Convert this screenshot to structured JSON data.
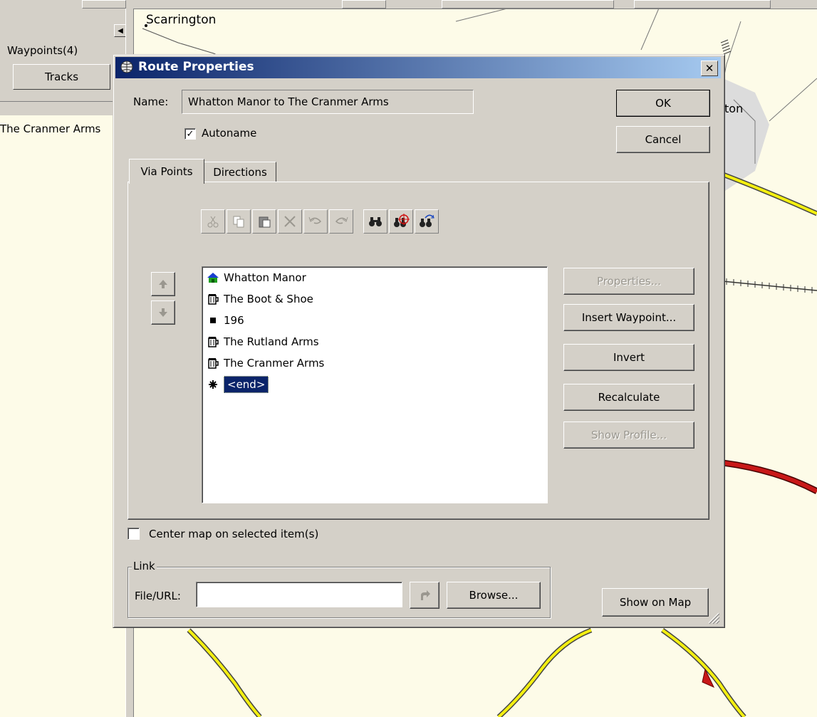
{
  "background": {
    "map_label": "Scarrington",
    "map_label2": "ton"
  },
  "left_panel": {
    "waypoints_tab": "Waypoints(4)",
    "tracks_tab": "Tracks",
    "route_item": "The Cranmer Arms"
  },
  "dialog": {
    "title": "Route Properties",
    "name_label": "Name:",
    "name_value": "Whatton Manor to The Cranmer Arms",
    "autoname_label": "Autoname",
    "autoname_checked": true,
    "ok_label": "OK",
    "cancel_label": "Cancel",
    "tabs": [
      {
        "label": "Via Points",
        "active": true
      },
      {
        "label": "Directions",
        "active": false
      }
    ],
    "toolbar_icons": [
      "cut-icon",
      "copy-icon",
      "paste-icon",
      "delete-icon",
      "undo-icon",
      "redo-icon",
      "find-icon",
      "find-target-icon",
      "find-next-icon"
    ],
    "via_points": [
      {
        "label": "Whatton Manor",
        "icon": "house-icon"
      },
      {
        "label": "The Boot & Shoe",
        "icon": "beer-icon"
      },
      {
        "label": "196",
        "icon": "square-icon"
      },
      {
        "label": "The Rutland Arms",
        "icon": "beer-icon"
      },
      {
        "label": "The Cranmer Arms",
        "icon": "beer-icon"
      },
      {
        "label": "<end>",
        "icon": "end-icon",
        "selected": true
      }
    ],
    "side_buttons": {
      "properties": "Properties...",
      "insert_waypoint": "Insert Waypoint...",
      "invert": "Invert",
      "recalculate": "Recalculate",
      "show_profile": "Show Profile..."
    },
    "center_map_label": "Center map on selected item(s)",
    "link_group_label": "Link",
    "file_url_label": "File/URL:",
    "file_url_value": "",
    "browse_label": "Browse...",
    "show_on_map_label": "Show on Map"
  },
  "colors": {
    "dialog_face": "#d4d0c8",
    "title_bar_start": "#0a246a",
    "title_bar_end": "#a6caf0",
    "selection": "#0a246a",
    "road_yellow": "#f3ef10",
    "road_red": "#c81818"
  }
}
